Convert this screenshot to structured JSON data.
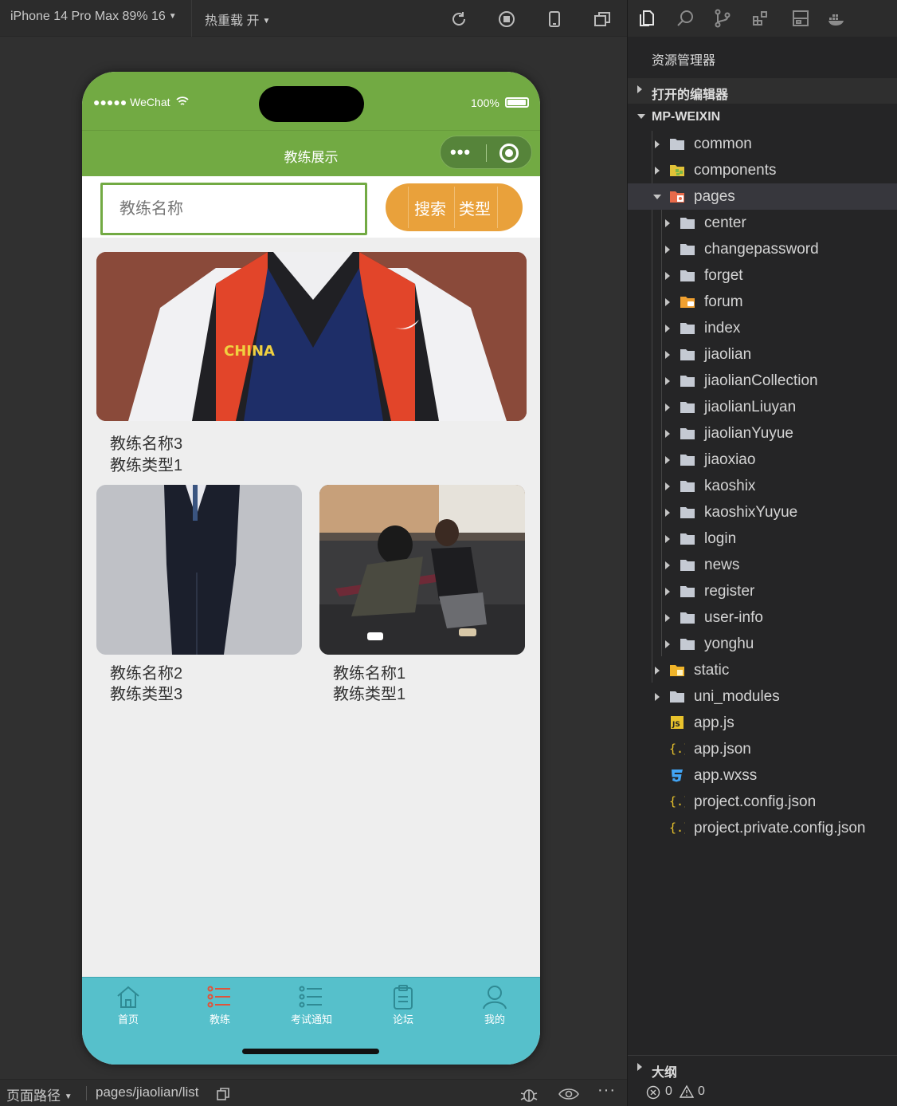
{
  "toolbar": {
    "device": "iPhone 14 Pro Max 89% 16",
    "hot_reload": "热重载 开"
  },
  "phone": {
    "status": {
      "carrier": "●●●●● WeChat",
      "battery": "100%"
    },
    "nav_title": "教练展示",
    "search": {
      "placeholder": "教练名称",
      "search_label": "搜索",
      "type_label": "类型"
    },
    "cards": [
      {
        "name": "教练名称3",
        "type": "教练类型1",
        "image": "coach-photo-china-vest"
      },
      {
        "name": "教练名称2",
        "type": "教练类型3",
        "image": "coach-photo-suit"
      },
      {
        "name": "教练名称1",
        "type": "教练类型1",
        "image": "coach-photo-gym"
      }
    ],
    "tabs": [
      {
        "label": "首页",
        "icon": "home-icon",
        "active": false
      },
      {
        "label": "教练",
        "icon": "list-icon",
        "active": true
      },
      {
        "label": "考试通知",
        "icon": "list-icon",
        "active": false
      },
      {
        "label": "论坛",
        "icon": "clipboard-icon",
        "active": false
      },
      {
        "label": "我的",
        "icon": "user-icon",
        "active": false
      }
    ],
    "colors": {
      "nav": "#72aa43",
      "tab_bar": "#56c0cb",
      "search_button": "#e9a13b",
      "active_tab_icon": "#e0533a"
    }
  },
  "bottom_bar": {
    "path_label": "页面路径",
    "path": "pages/jiaolian/list"
  },
  "explorer": {
    "title": "资源管理器",
    "open_editors": "打开的编辑器",
    "project": "MP-WEIXIN",
    "outline": "大纲",
    "tree": [
      {
        "label": "common",
        "kind": "folder"
      },
      {
        "label": "components",
        "kind": "folder-components"
      },
      {
        "label": "pages",
        "kind": "folder-pages",
        "expanded": true
      },
      {
        "label": "center",
        "kind": "folder"
      },
      {
        "label": "changepassword",
        "kind": "folder"
      },
      {
        "label": "forget",
        "kind": "folder"
      },
      {
        "label": "forum",
        "kind": "folder-forum"
      },
      {
        "label": "index",
        "kind": "folder"
      },
      {
        "label": "jiaolian",
        "kind": "folder"
      },
      {
        "label": "jiaolianCollection",
        "kind": "folder"
      },
      {
        "label": "jiaolianLiuyan",
        "kind": "folder"
      },
      {
        "label": "jiaolianYuyue",
        "kind": "folder"
      },
      {
        "label": "jiaoxiao",
        "kind": "folder"
      },
      {
        "label": "kaoshix",
        "kind": "folder"
      },
      {
        "label": "kaoshixYuyue",
        "kind": "folder"
      },
      {
        "label": "login",
        "kind": "folder"
      },
      {
        "label": "news",
        "kind": "folder"
      },
      {
        "label": "register",
        "kind": "folder"
      },
      {
        "label": "user-info",
        "kind": "folder"
      },
      {
        "label": "yonghu",
        "kind": "folder"
      },
      {
        "label": "static",
        "kind": "folder-static"
      },
      {
        "label": "uni_modules",
        "kind": "folder"
      },
      {
        "label": "app.js",
        "kind": "js-file"
      },
      {
        "label": "app.json",
        "kind": "json-file"
      },
      {
        "label": "app.wxss",
        "kind": "css-file"
      },
      {
        "label": "project.config.json",
        "kind": "json-file"
      },
      {
        "label": "project.private.config.json",
        "kind": "json-file"
      }
    ],
    "errors": "0",
    "warnings": "0"
  }
}
